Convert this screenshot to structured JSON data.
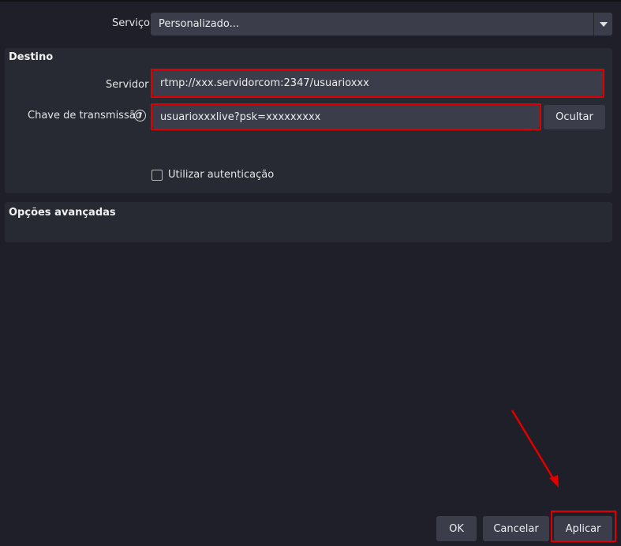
{
  "service": {
    "label": "Serviço",
    "value": "Personalizado..."
  },
  "destination": {
    "title": "Destino",
    "server_label": "Servidor",
    "server_value": "rtmp://xxx.servidorcom:2347/usuarioxxx",
    "key_label": "Chave de transmissão",
    "key_value": "usuarioxxxlive?psk=xxxxxxxxx",
    "hide_button": "Ocultar",
    "auth_label": "Utilizar autenticação"
  },
  "advanced": {
    "title": "Opções avançadas"
  },
  "footer": {
    "ok": "OK",
    "cancel": "Cancelar",
    "apply": "Aplicar"
  },
  "colors": {
    "highlight": "#e00000",
    "background": "#1e1f28",
    "panel": "#272a33",
    "field": "#3b3e4a"
  },
  "icons": {
    "help": "question-circle-icon",
    "dropdown": "chevron-down-icon"
  }
}
